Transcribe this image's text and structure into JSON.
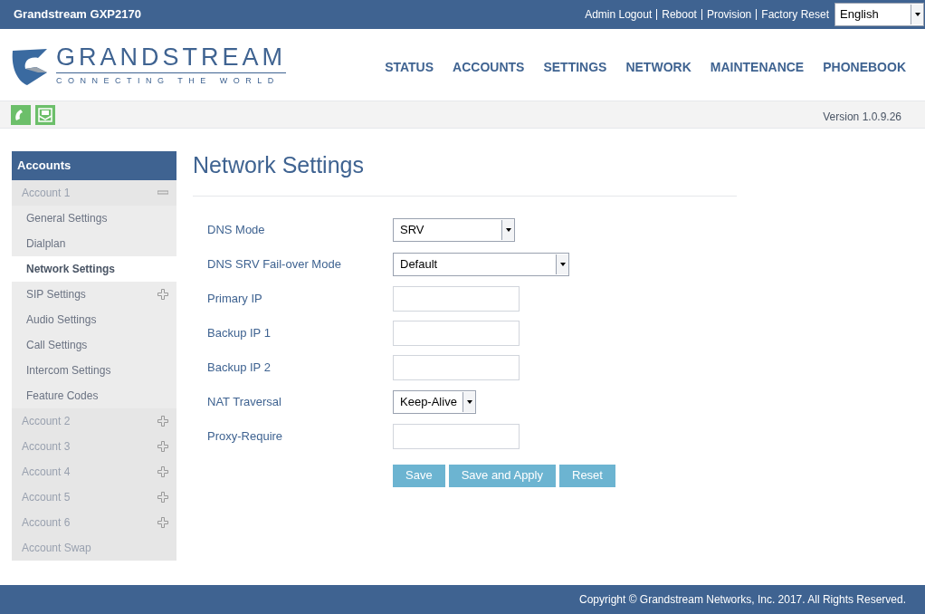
{
  "top_bar": {
    "title": "Grandstream GXP2170",
    "links": [
      "Admin Logout",
      "Reboot",
      "Provision",
      "Factory Reset"
    ],
    "language": "English"
  },
  "logo": {
    "name": "GRANDSTREAM",
    "tagline": "CONNECTING THE WORLD"
  },
  "nav": [
    {
      "label": "STATUS"
    },
    {
      "label": "ACCOUNTS"
    },
    {
      "label": "SETTINGS"
    },
    {
      "label": "NETWORK"
    },
    {
      "label": "MAINTENANCE"
    },
    {
      "label": "PHONEBOOK"
    }
  ],
  "version": "Version 1.0.9.26",
  "sidebar": {
    "title": "Accounts",
    "items": [
      {
        "label": "Account 1",
        "expanded": true,
        "selected": false,
        "children": [
          {
            "label": "General Settings",
            "selected": false
          },
          {
            "label": "Dialplan",
            "selected": false
          },
          {
            "label": "Network Settings",
            "selected": true
          },
          {
            "label": "SIP Settings",
            "selected": false,
            "expanded": false
          },
          {
            "label": "Audio Settings",
            "selected": false
          },
          {
            "label": "Call Settings",
            "selected": false
          },
          {
            "label": "Intercom Settings",
            "selected": false
          },
          {
            "label": "Feature Codes",
            "selected": false
          }
        ]
      },
      {
        "label": "Account 2",
        "expanded": false,
        "selected": false
      },
      {
        "label": "Account 3",
        "expanded": false,
        "selected": false
      },
      {
        "label": "Account 4",
        "expanded": false,
        "selected": false
      },
      {
        "label": "Account 5",
        "expanded": false,
        "selected": false
      },
      {
        "label": "Account 6",
        "expanded": false,
        "selected": false
      },
      {
        "label": "Account Swap",
        "selected": false
      }
    ]
  },
  "page_title": "Network Settings",
  "fields": [
    {
      "label": "DNS Mode",
      "kind": "select",
      "value": "SRV"
    },
    {
      "label": "DNS SRV Fail-over Mode",
      "kind": "select",
      "value": "Default"
    },
    {
      "label": "Primary IP",
      "kind": "text"
    },
    {
      "label": "Backup IP 1",
      "kind": "text"
    },
    {
      "label": "Backup IP 2",
      "kind": "text"
    },
    {
      "label": "NAT Traversal",
      "kind": "select",
      "value": "Keep-Alive"
    },
    {
      "label": "Proxy-Require",
      "kind": "text"
    }
  ],
  "buttons": [
    "Save",
    "Save and Apply",
    "Reset"
  ],
  "footer": "Copyright © Grandstream Networks, Inc. 2017. All Rights Reserved."
}
